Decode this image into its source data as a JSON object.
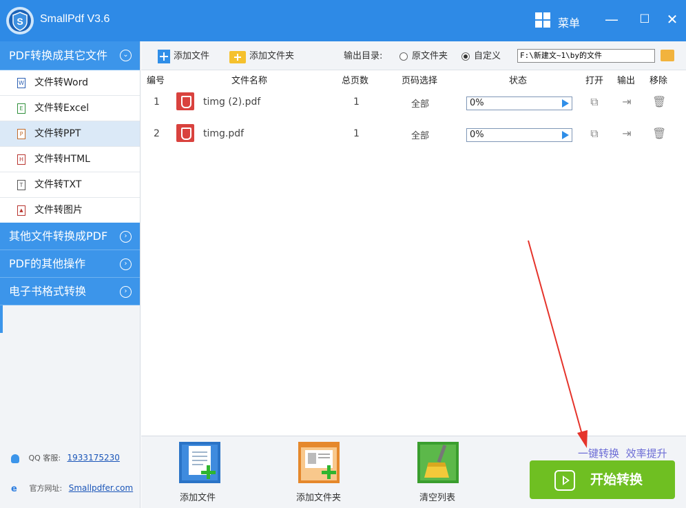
{
  "app": {
    "title": "SmallPdf V3.6",
    "menu_label": "菜单"
  },
  "window_controls": {
    "minimize": "—",
    "maximize": "☐",
    "close": "✕"
  },
  "sidebar": {
    "open_category": "PDF转换成其它文件",
    "sub_items": [
      "文件转Word",
      "文件转Excel",
      "文件转PPT",
      "文件转HTML",
      "文件转TXT",
      "文件转图片"
    ],
    "sub_icons": [
      "W",
      "E",
      "P",
      "H",
      "T",
      "▲"
    ],
    "active_item": "文件转PPT",
    "categories": [
      "其他文件转换成PDF",
      "PDF的其他操作",
      "电子书格式转换"
    ],
    "qq_label": "QQ 客服:",
    "qq_number": "1933175230",
    "website_label": "官方网址:",
    "website": "Smallpdfer.com"
  },
  "toolbar": {
    "add_file": "添加文件",
    "add_folder": "添加文件夹",
    "output_label": "输出目录:",
    "option_original": "原文件夹",
    "option_custom": "自定义",
    "selected_option": "自定义",
    "output_path": "F:\\新建文~1\\by的文件"
  },
  "table": {
    "headers": [
      "编号",
      "文件名称",
      "总页数",
      "页码选择",
      "状态",
      "打开",
      "输出",
      "移除"
    ],
    "rows": [
      {
        "index": "1",
        "name": "timg (2).pdf",
        "pages": "1",
        "range": "全部",
        "status": "0%"
      },
      {
        "index": "2",
        "name": "timg.pdf",
        "pages": "1",
        "range": "全部",
        "status": "0%"
      }
    ]
  },
  "bottom": {
    "add_file": "添加文件",
    "add_folder": "添加文件夹",
    "clear_list": "清空列表",
    "promo_left": "一键转换",
    "promo_right": "效率提升",
    "start_button": "开始转换"
  },
  "colors": {
    "titlebar": "#2e8ae6",
    "sidebar_category": "#3c95ea",
    "start_button": "#6fbf22",
    "annotation_arrow": "#e5332a"
  }
}
